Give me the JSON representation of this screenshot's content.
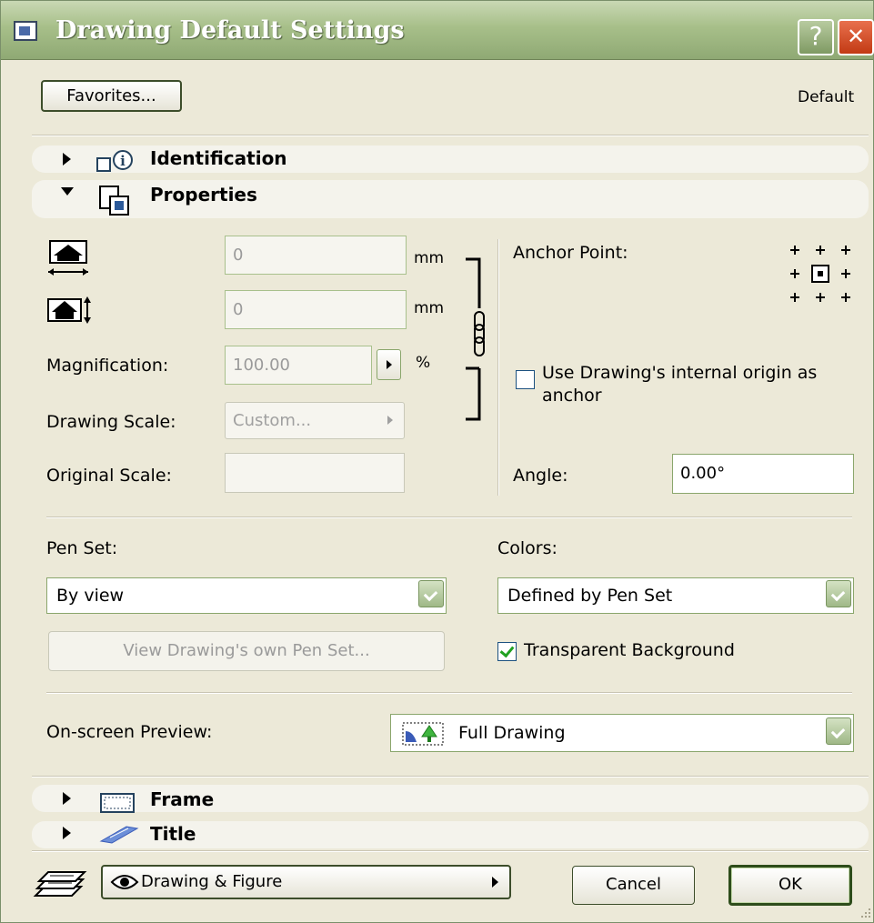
{
  "window": {
    "title": "Drawing Default Settings",
    "help_label": "?",
    "close_label": "✕"
  },
  "top": {
    "favorites_label": "Favorites...",
    "default_label": "Default"
  },
  "sections": {
    "identification": "Identification",
    "properties": "Properties",
    "frame": "Frame",
    "title": "Title"
  },
  "properties": {
    "width_value": "0",
    "width_unit": "mm",
    "height_value": "0",
    "height_unit": "mm",
    "magnification_label": "Magnification:",
    "magnification_value": "100.00",
    "magnification_unit": "%",
    "drawing_scale_label": "Drawing Scale:",
    "drawing_scale_value": "Custom...",
    "original_scale_label": "Original Scale:",
    "original_scale_value": "",
    "anchor_point_label": "Anchor Point:",
    "use_origin_label_line1": "Use Drawing's internal origin as",
    "use_origin_label_line2": "anchor",
    "use_origin_checked": false,
    "angle_label": "Angle:",
    "angle_value": "0.00°",
    "pen_set_label": "Pen Set:",
    "pen_set_value": "By view",
    "view_pen_set_label": "View Drawing's own Pen Set...",
    "colors_label": "Colors:",
    "colors_value": "Defined by Pen Set",
    "transparent_bg_label": "Transparent Background",
    "transparent_bg_checked": true,
    "preview_label": "On-screen Preview:",
    "preview_value": "Full Drawing"
  },
  "footer": {
    "layer_value": "Drawing & Figure",
    "cancel_label": "Cancel",
    "ok_label": "OK"
  },
  "icons": [
    "app-icon",
    "help-icon",
    "close-icon",
    "identification-icon",
    "properties-icon",
    "width-icon",
    "height-icon",
    "chain-link-icon",
    "anchor-point-icon",
    "full-drawing-icon",
    "frame-icon",
    "title-icon",
    "layers-icon",
    "eye-icon"
  ]
}
